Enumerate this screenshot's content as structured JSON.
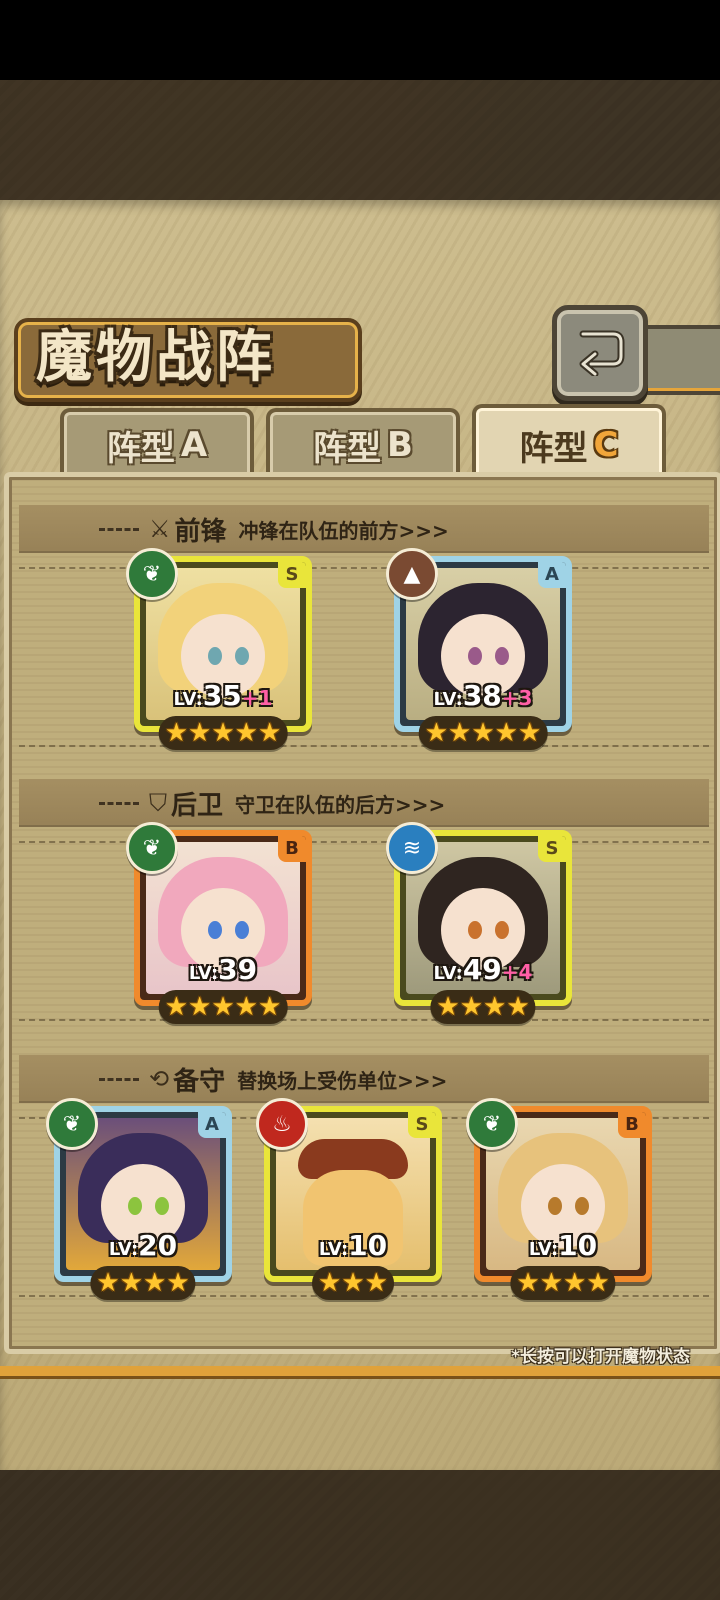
{
  "header": {
    "title": "魔物战阵",
    "back_icon": "return-arrow-icon"
  },
  "tabs": [
    {
      "label": "阵型",
      "letter": "A",
      "active": false
    },
    {
      "label": "阵型",
      "letter": "B",
      "active": false
    },
    {
      "label": "阵型",
      "letter": "C",
      "active": true
    }
  ],
  "sections": {
    "front": {
      "icon": "sword-icon",
      "title": "前锋",
      "desc": "冲锋在队伍的前方>>>"
    },
    "back": {
      "icon": "shield-icon",
      "title": "后卫",
      "desc": "守卫在队伍的后方>>>"
    },
    "reserve": {
      "icon": "swap-icon",
      "title": "备守",
      "desc": "替换场上受伤单位>>>"
    }
  },
  "units": {
    "front_1": {
      "rank": "S",
      "element": "leaf",
      "lv_prefix": "LV:",
      "level": "35",
      "bonus": "+1",
      "stars": 5
    },
    "front_2": {
      "rank": "A",
      "element": "earth",
      "lv_prefix": "LV:",
      "level": "38",
      "bonus": "+3",
      "stars": 5
    },
    "back_1": {
      "rank": "B",
      "element": "leaf",
      "lv_prefix": "LV:",
      "level": "39",
      "bonus": "",
      "stars": 5
    },
    "back_2": {
      "rank": "S",
      "element": "water",
      "lv_prefix": "LV:",
      "level": "49",
      "bonus": "+4",
      "stars": 4
    },
    "reserve_1": {
      "rank": "A",
      "element": "leaf",
      "lv_prefix": "LV:",
      "level": "20",
      "bonus": "",
      "stars": 4
    },
    "reserve_2": {
      "rank": "S",
      "element": "fire",
      "lv_prefix": "LV:",
      "level": "10",
      "bonus": "",
      "stars": 3
    },
    "reserve_3": {
      "rank": "B",
      "element": "leaf",
      "lv_prefix": "LV:",
      "level": "10",
      "bonus": "",
      "stars": 4
    }
  },
  "footer": {
    "note": "*长按可以打开魔物状态"
  },
  "colors": {
    "rank_S": "#e9e53a",
    "rank_A": "#9fd3e6",
    "rank_B": "#f08a2c",
    "star": "#ffc62e",
    "level_bonus": "#ff5fa6"
  }
}
